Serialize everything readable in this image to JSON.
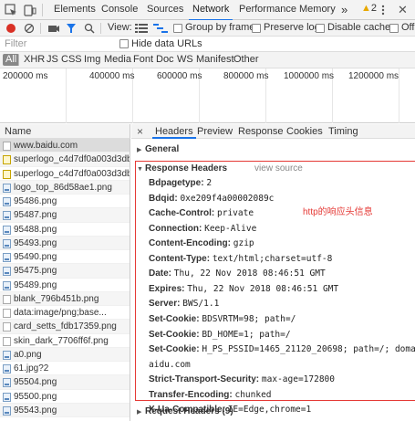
{
  "devtools": {
    "tabs": [
      "Elements",
      "Console",
      "Sources",
      "Network",
      "Performance",
      "Memory"
    ],
    "more": "»",
    "warning_count": "2"
  },
  "toolbar": {
    "view_label": "View:",
    "group_by_frame": "Group by frame",
    "preserve_log": "Preserve log",
    "disable_cache": "Disable cache",
    "offline": "Offli"
  },
  "filter": {
    "placeholder": "Filter",
    "hide_data_urls": "Hide data URLs"
  },
  "types": [
    "All",
    "XHR",
    "JS",
    "CSS",
    "Img",
    "Media",
    "Font",
    "Doc",
    "WS",
    "Manifest",
    "Other"
  ],
  "timeline": {
    "ticks": [
      "200000 ms",
      "400000 ms",
      "600000 ms",
      "800000 ms",
      "1000000 ms",
      "1200000 ms"
    ]
  },
  "list": {
    "header": "Name",
    "items": [
      {
        "name": "www.baidu.com",
        "kind": "doc"
      },
      {
        "name": "superlogo_c4d7df0a003d3db...",
        "kind": "js"
      },
      {
        "name": "superlogo_c4d7df0a003d3db...",
        "kind": "js"
      },
      {
        "name": "logo_top_86d58ae1.png",
        "kind": "img"
      },
      {
        "name": "95486.png",
        "kind": "img"
      },
      {
        "name": "95487.png",
        "kind": "img"
      },
      {
        "name": "95488.png",
        "kind": "img"
      },
      {
        "name": "95493.png",
        "kind": "img"
      },
      {
        "name": "95490.png",
        "kind": "img"
      },
      {
        "name": "95475.png",
        "kind": "img"
      },
      {
        "name": "95489.png",
        "kind": "img"
      },
      {
        "name": "blank_796b451b.png",
        "kind": "doc"
      },
      {
        "name": "data:image/png;base...",
        "kind": "doc"
      },
      {
        "name": "card_setts_fdb17359.png",
        "kind": "doc"
      },
      {
        "name": "skin_dark_7706ff6f.png",
        "kind": "doc"
      },
      {
        "name": "a0.png",
        "kind": "img"
      },
      {
        "name": "61.jpg?2",
        "kind": "img"
      },
      {
        "name": "95504.png",
        "kind": "img"
      },
      {
        "name": "95500.png",
        "kind": "img"
      },
      {
        "name": "95543.png",
        "kind": "img"
      }
    ]
  },
  "detail": {
    "close": "×",
    "tabs": [
      "Headers",
      "Preview",
      "Response",
      "Cookies",
      "Timing"
    ],
    "general": "General",
    "response_headers": "Response Headers",
    "view_source": "view source",
    "annotation": "http的响应头信息",
    "headers": [
      {
        "k": "Bdpagetype:",
        "v": "2"
      },
      {
        "k": "Bdqid:",
        "v": "0xe209f4a00002089c"
      },
      {
        "k": "Cache-Control:",
        "v": "private"
      },
      {
        "k": "Connection:",
        "v": "Keep-Alive"
      },
      {
        "k": "Content-Encoding:",
        "v": "gzip"
      },
      {
        "k": "Content-Type:",
        "v": "text/html;charset=utf-8"
      },
      {
        "k": "Date:",
        "v": "Thu, 22 Nov 2018 08:46:51 GMT"
      },
      {
        "k": "Expires:",
        "v": "Thu, 22 Nov 2018 08:46:51 GMT"
      },
      {
        "k": "Server:",
        "v": "BWS/1.1"
      },
      {
        "k": "Set-Cookie:",
        "v": "BDSVRTM=98; path=/"
      },
      {
        "k": "Set-Cookie:",
        "v": "BD_HOME=1; path=/"
      },
      {
        "k": "Set-Cookie:",
        "v": "H_PS_PSSID=1465_21120_20698; path=/; domain=.b"
      },
      {
        "k": "",
        "v": "aidu.com"
      },
      {
        "k": "Strict-Transport-Security:",
        "v": "max-age=172800"
      },
      {
        "k": "Transfer-Encoding:",
        "v": "chunked"
      },
      {
        "k": "X-Ua-Compatible:",
        "v": "IE=Edge,chrome=1"
      }
    ],
    "request_headers": "Request Headers (9)"
  }
}
